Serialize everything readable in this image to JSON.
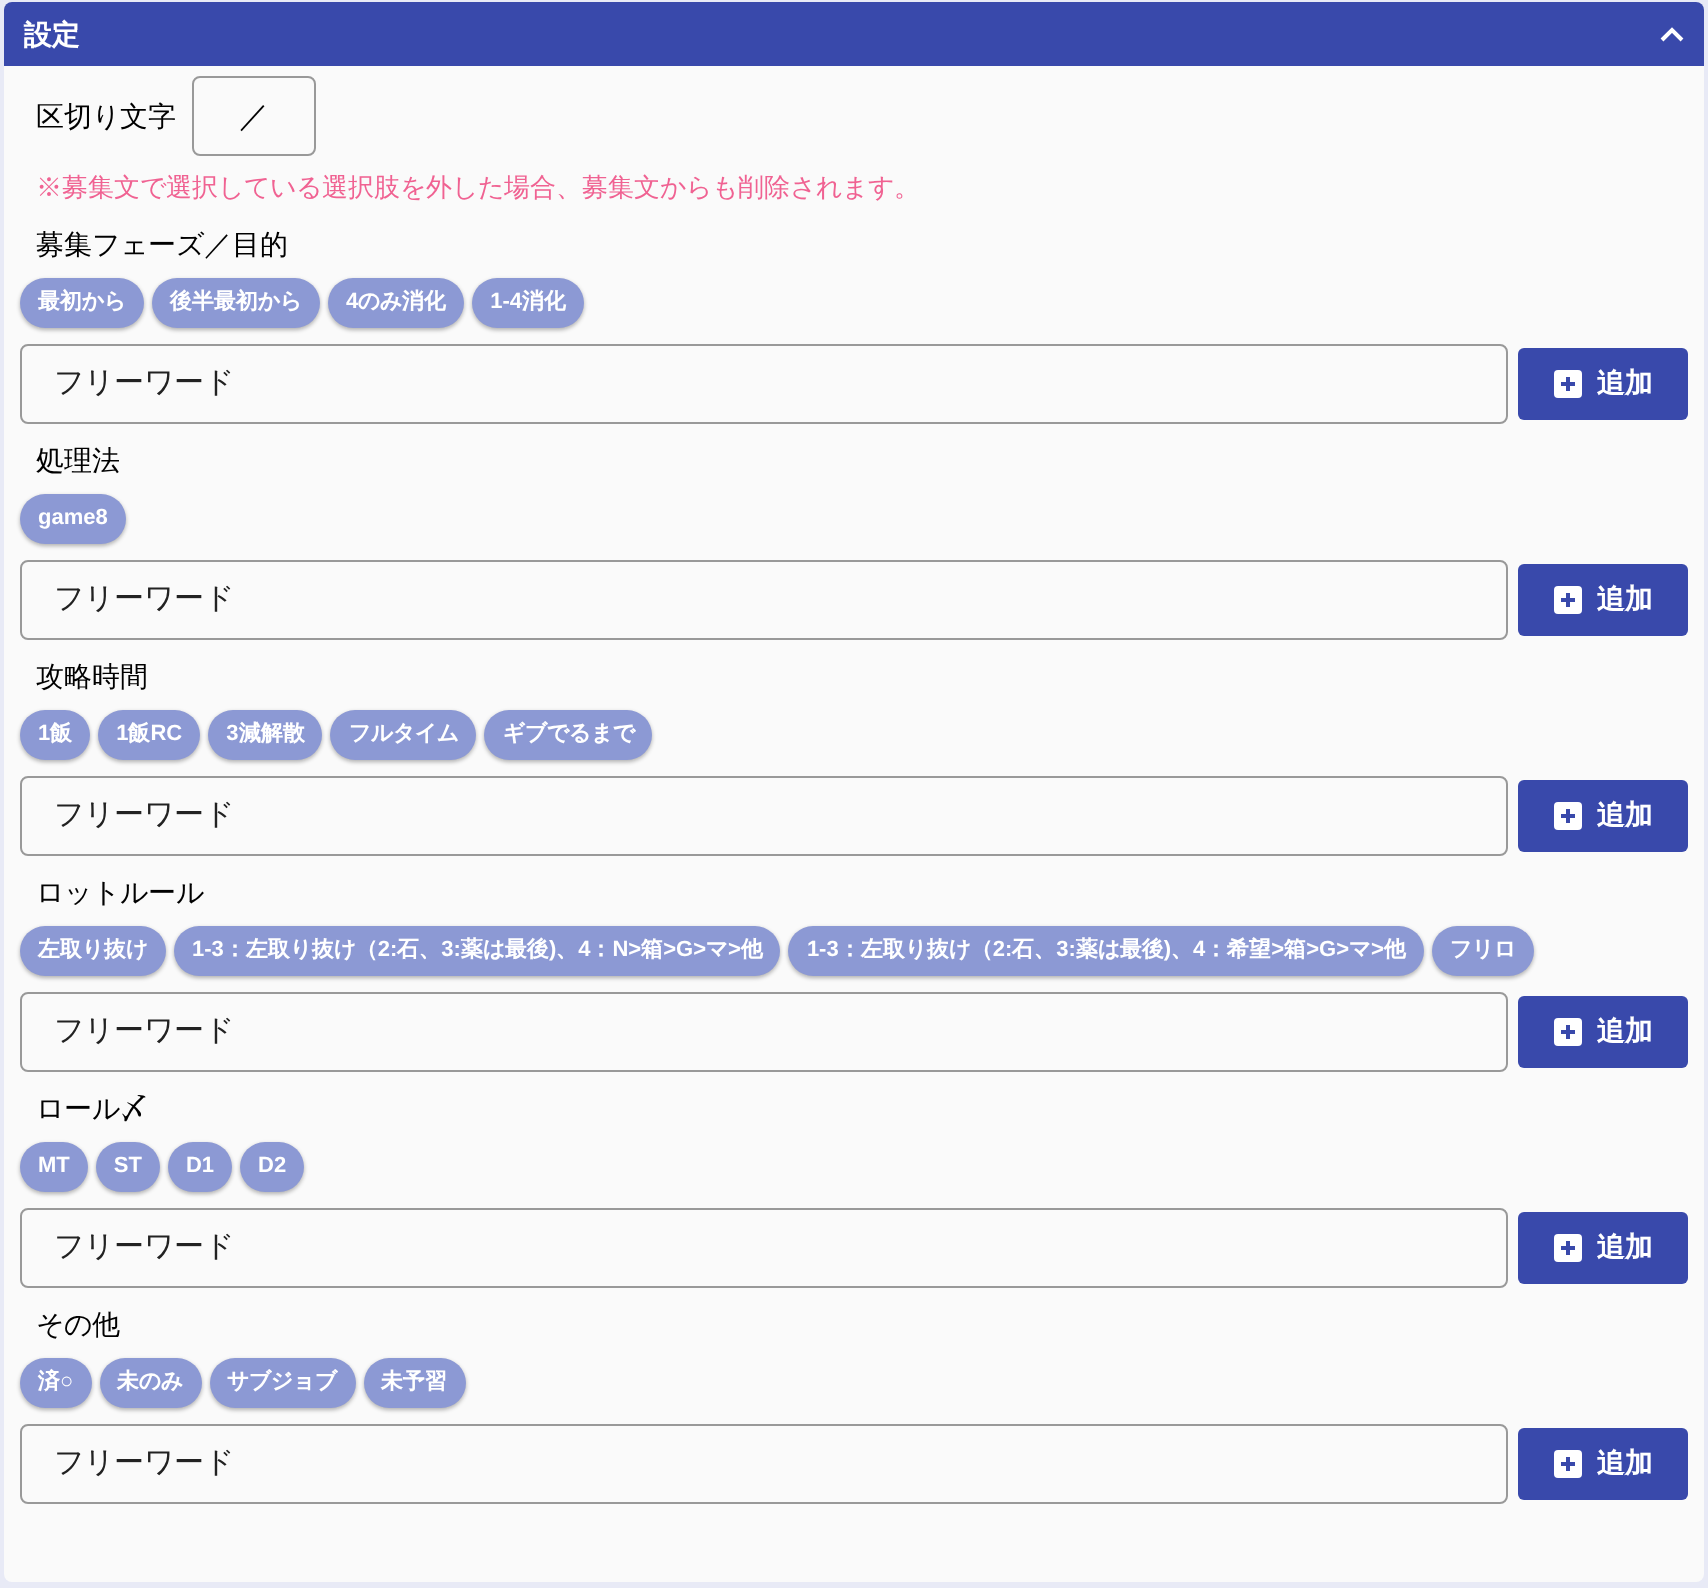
{
  "panel": {
    "title": "設定",
    "expanded": true
  },
  "separator": {
    "label": "区切り文字",
    "value": "／"
  },
  "notice": "※募集文で選択している選択肢を外した場合、募集文からも削除されます。",
  "sections": [
    {
      "label": "募集フェーズ／目的",
      "chips": [
        "最初から",
        "後半最初から",
        "4のみ消化",
        "1-4消化"
      ],
      "input": {
        "placeholder": "フリーワード"
      },
      "button": "追加"
    },
    {
      "label": "処理法",
      "chips": [
        "game8"
      ],
      "input": {
        "placeholder": "フリーワード"
      },
      "button": "追加"
    },
    {
      "label": "攻略時間",
      "chips": [
        "1飯",
        "1飯RC",
        "3減解散",
        "フルタイム",
        "ギブでるまで"
      ],
      "input": {
        "placeholder": "フリーワード"
      },
      "button": "追加"
    },
    {
      "label": "ロットルール",
      "chips": [
        "左取り抜け",
        "1-3：左取り抜け（2:石、3:薬は最後)、4：N>箱>G>マ>他",
        "1-3：左取り抜け（2:石、3:薬は最後)、4：希望>箱>G>マ>他",
        "フリロ"
      ],
      "input": {
        "placeholder": "フリーワード"
      },
      "button": "追加"
    },
    {
      "label": "ロール〆",
      "chips": [
        "MT",
        "ST",
        "D1",
        "D2"
      ],
      "input": {
        "placeholder": "フリーワード"
      },
      "button": "追加"
    },
    {
      "label": "その他",
      "chips": [
        "済○",
        "未のみ",
        "サブジョブ",
        "未予習"
      ],
      "input": {
        "placeholder": "フリーワード"
      },
      "button": "追加"
    }
  ]
}
